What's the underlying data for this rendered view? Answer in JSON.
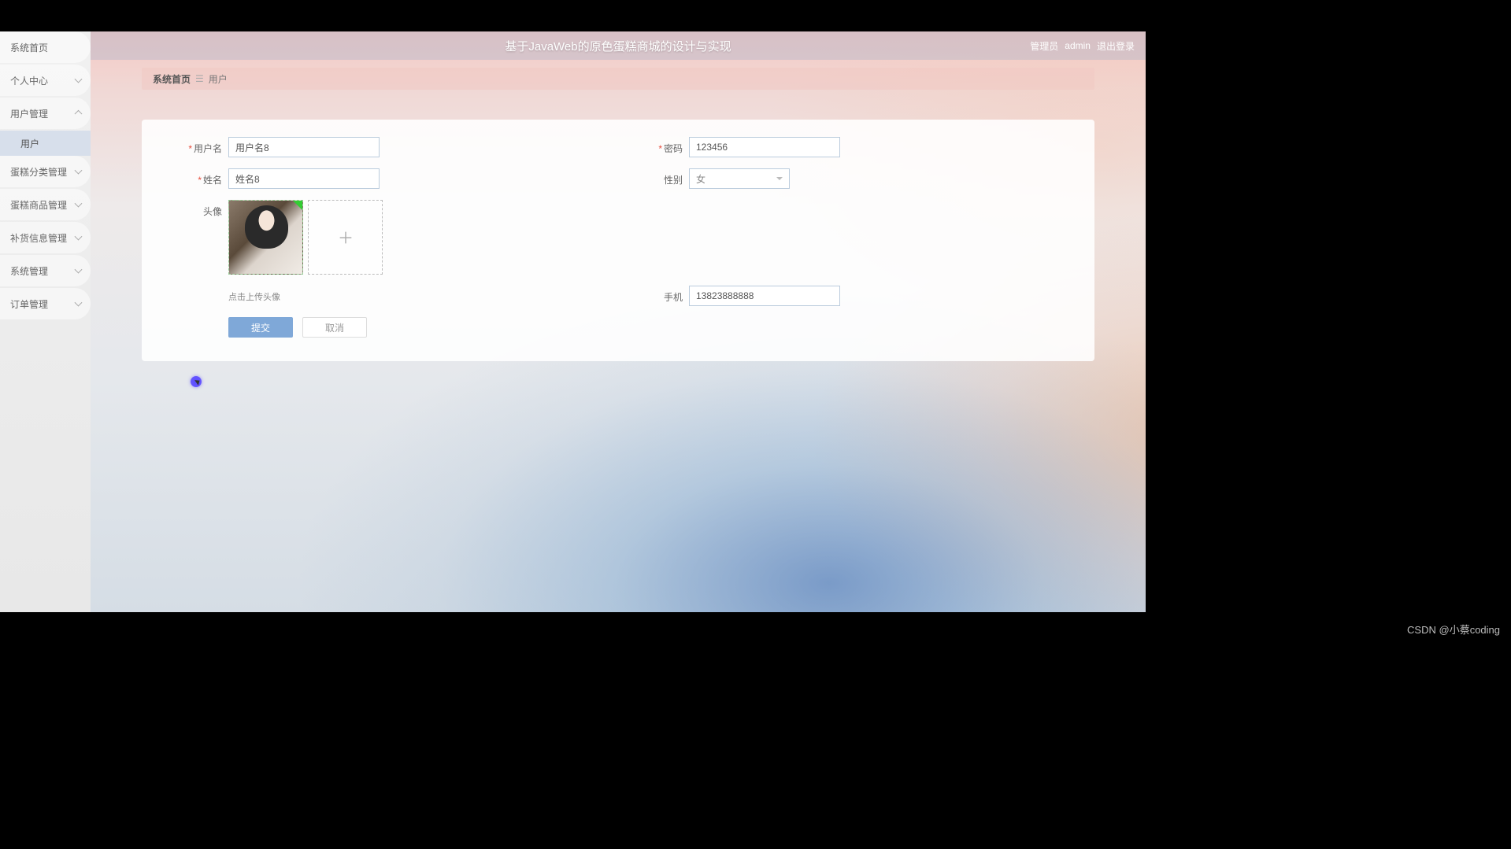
{
  "header": {
    "title": "基于JavaWeb的原色蛋糕商城的设计与实现",
    "role_prefix": "管理员",
    "username": "admin",
    "logout": "退出登录"
  },
  "sidebar": {
    "items": [
      {
        "label": "系统首页",
        "arrow": false
      },
      {
        "label": "个人中心",
        "arrow": true
      },
      {
        "label": "用户管理",
        "arrow": true,
        "expanded": true,
        "sub": [
          {
            "label": "用户"
          }
        ]
      },
      {
        "label": "蛋糕分类管理",
        "arrow": true
      },
      {
        "label": "蛋糕商品管理",
        "arrow": true
      },
      {
        "label": "补货信息管理",
        "arrow": true
      },
      {
        "label": "系统管理",
        "arrow": true
      },
      {
        "label": "订单管理",
        "arrow": true
      }
    ]
  },
  "breadcrumb": {
    "home": "系统首页",
    "current": "用户"
  },
  "form": {
    "username_label": "用户名",
    "username_value": "用户名8",
    "password_label": "密码",
    "password_value": "123456",
    "realname_label": "姓名",
    "realname_value": "姓名8",
    "gender_label": "性别",
    "gender_value": "女",
    "avatar_label": "头像",
    "upload_hint": "点击上传头像",
    "phone_label": "手机",
    "phone_value": "13823888888",
    "submit": "提交",
    "cancel": "取消"
  },
  "watermark": "CSDN @小蔡coding"
}
